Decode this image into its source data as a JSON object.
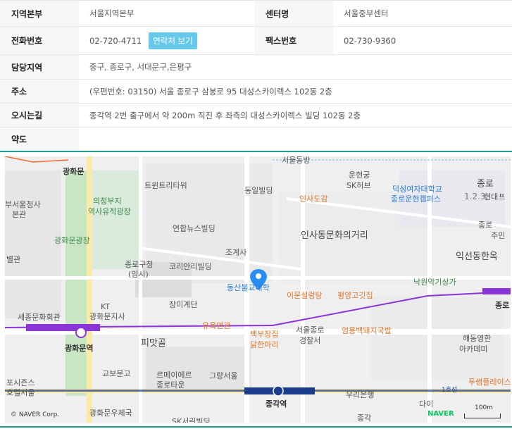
{
  "info": {
    "hq_label": "지역본부",
    "hq_value": "서울지역본부",
    "center_label": "센터명",
    "center_value": "서울중부센터",
    "phone_label": "전화번호",
    "phone_value": "02-720-4711",
    "contact_button": "연락처 보기",
    "fax_label": "팩스번호",
    "fax_value": "02-730-9360",
    "area_label": "담당지역",
    "area_value": "중구, 종로구, 서대문구,은평구",
    "address_label": "주소",
    "address_value": "(우편번호: 03150) 서울 종로구 삼봉로 95 대성스카이렉스 102동 2층",
    "directions_label": "오시는길",
    "directions_value": "종각역 2번 출구에서 약 200m 직진 후 좌측의 대성스카이렉스 빌딩 102동 2층",
    "map_label": "약도"
  },
  "map": {
    "labels": {
      "gwanghwamun": "광화문",
      "seoul_office": "부서울청사",
      "seoul_office2": "본관",
      "uijeongbu": "의정부지",
      "uijeongbu2": "역사유적광장",
      "gwanghwamun_square": "광화문광장",
      "annex": "별관",
      "sejong": "세종문화회관",
      "kt": "KT",
      "kt2": "광화문지사",
      "gwanghwamun_station": "광화문역",
      "twin_tree": "트윈트리타워",
      "yonhap": "연합뉴스빌딩",
      "jongno_office": "종로구청",
      "jongno_office2": "(임시)",
      "korean_building": "코리안리빌딩",
      "jangmi": "장미계단",
      "pimatgol": "피맛골",
      "gyobomungo": "교보문고",
      "le_meilleur": "르메이에르",
      "le_meilleur2": "종로타운",
      "grand_seoul": "그랑서울",
      "posijeuns": "포시즌스",
      "posijeuns2": "호텔서울",
      "gwanghwamun_post": "광화문우체국",
      "sk_building": "SK서린빌딩",
      "dongil": "동일빌딩",
      "jogyesa": "조계사",
      "dongsan": "동산불교대학",
      "yurumyeon": "유욕면관",
      "baekbu": "백부장집",
      "baekbu2": "닭한마리",
      "seoul_jongno": "서울종로",
      "seoul_jongno2": "경찰서",
      "jonggak": "종각역",
      "imun": "이문설렁탕",
      "pyeongyang": "평양고깃집",
      "eomyong": "엄용백돼지국밥",
      "insadong": "인사동문화의거리",
      "insadogam": "인사도감",
      "unhyeon": "운현궁",
      "unhyeon2": "SK허브",
      "duksung": "덕성여자대학교",
      "duksung2": "종로운현캠퍼스",
      "jongno_123": "종로",
      "jongno_123b": "1.2.3.",
      "hyundai": "현대프",
      "iksun": "익선동한옥",
      "nakwon": "낙원악기상가",
      "woori": "우리은행",
      "haedong": "해동영한",
      "haedong2": "아카데미",
      "tusseom": "투썸플레이스",
      "daishin": "다이",
      "jonggak_area": "종각",
      "seoul_dongbu": "서울동방",
      "line1": "1호선",
      "jongro_ju": "종로",
      "jongro_ju2": "주민",
      "jongno_st": "종로"
    },
    "copyright": "© NAVER Corp.",
    "naver_logo": "NAVER",
    "scale": "100m"
  }
}
